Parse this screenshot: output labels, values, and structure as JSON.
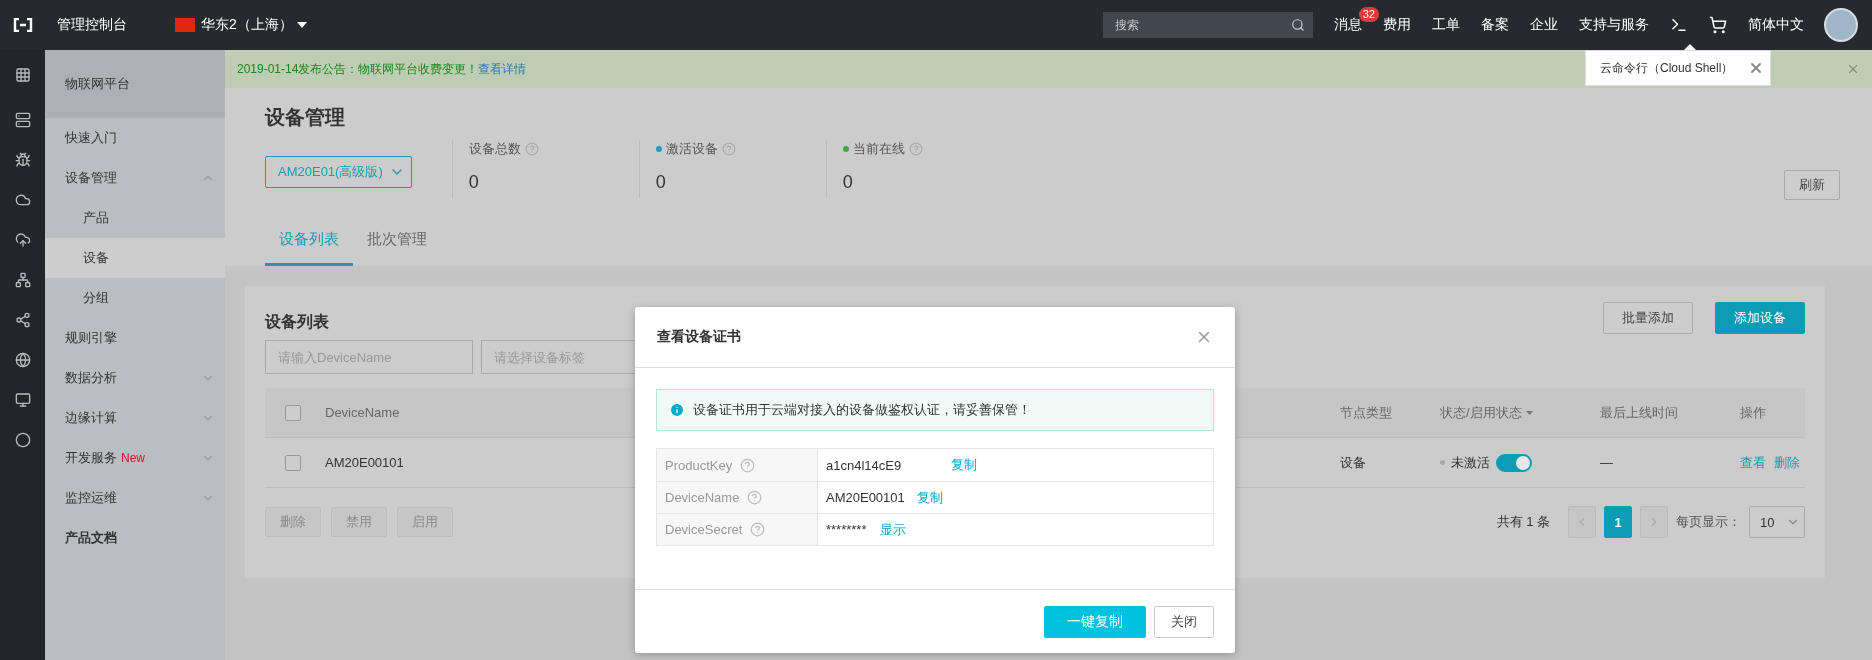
{
  "topbar": {
    "console": "管理控制台",
    "region": "华东2（上海）",
    "search": {
      "placeholder": "搜索"
    },
    "nav": [
      {
        "label": "消息",
        "badge": "32"
      },
      {
        "label": "费用"
      },
      {
        "label": "工单"
      },
      {
        "label": "备案"
      },
      {
        "label": "企业"
      },
      {
        "label": "支持与服务"
      }
    ],
    "language": "简体中文"
  },
  "cloud_shell_tip": {
    "label": "云命令行（Cloud Shell）"
  },
  "sidebar": {
    "title": "物联网平台",
    "items": [
      {
        "label": "快速入门",
        "selected": false
      },
      {
        "label": "设备管理",
        "selected": false,
        "expanded": true,
        "children": [
          {
            "label": "产品",
            "selected": false
          },
          {
            "label": "设备",
            "selected": true
          },
          {
            "label": "分组",
            "selected": false
          }
        ]
      },
      {
        "label": "规则引擎",
        "selected": false
      },
      {
        "label": "数据分析",
        "selected": false,
        "expanded": false
      },
      {
        "label": "边缘计算",
        "selected": false,
        "expanded": false
      },
      {
        "label": "开发服务",
        "selected": false,
        "expanded": false,
        "badge": "New"
      },
      {
        "label": "监控运维",
        "selected": false,
        "expanded": false
      },
      {
        "label": "产品文档",
        "selected": false,
        "kind": "doc"
      }
    ]
  },
  "notice": {
    "text": "2019-01-14发布公告：物联网平台收费变更！",
    "link": "查看详情"
  },
  "page": {
    "title": "设备管理",
    "product_select": "AM20E01(高级版)",
    "stats": [
      {
        "label": "设备总数",
        "value": "0"
      },
      {
        "label": "激活设备",
        "value": "0",
        "color": "#1a9fc0"
      },
      {
        "label": "当前在线",
        "value": "0",
        "color": "#3faa4a"
      }
    ],
    "refresh": "刷新",
    "tabs": [
      {
        "label": "设备列表",
        "selected": true
      },
      {
        "label": "批次管理",
        "selected": false
      }
    ]
  },
  "device_list": {
    "title": "设备列表",
    "buttons": [
      {
        "label": "批量添加",
        "kind": "default"
      },
      {
        "label": "添加设备",
        "kind": "primary"
      }
    ],
    "filters": [
      {
        "placeholder": "请输入DeviceName"
      },
      {
        "placeholder": "请选择设备标签"
      }
    ],
    "columns": [
      "DeviceName",
      "节点类型",
      "状态/启用状态",
      "最后上线时间",
      "操作"
    ],
    "header_checked": false,
    "rows": [
      {
        "checked": false,
        "device_name": "AM20E00101",
        "node_type": "设备",
        "status": "未激活",
        "enabled": true,
        "last_online": "—",
        "actions": [
          "查看",
          "删除"
        ]
      }
    ],
    "bulk_actions": [
      {
        "label": "删除",
        "disabled": true
      },
      {
        "label": "禁用",
        "disabled": true
      },
      {
        "label": "启用",
        "disabled": true
      }
    ],
    "pagination": {
      "total": "共有 1 条",
      "pages": [
        {
          "label": "1",
          "selected": true
        }
      ],
      "page_size_label": "每页显示：",
      "page_size": "10"
    }
  },
  "modal": {
    "title": "查看设备证书",
    "info": "设备证书用于云端对接入的设备做鉴权认证，请妥善保管！",
    "fields": [
      {
        "label": "ProductKey",
        "value": "a1cn4l14cE9",
        "action": "复制"
      },
      {
        "label": "DeviceName",
        "value": "AM20E00101",
        "action": "复制"
      },
      {
        "label": "DeviceSecret",
        "value": "********",
        "action": "显示"
      }
    ],
    "buttons": [
      {
        "label": "一键复制",
        "kind": "primary"
      },
      {
        "label": "关闭",
        "kind": "default"
      }
    ]
  }
}
